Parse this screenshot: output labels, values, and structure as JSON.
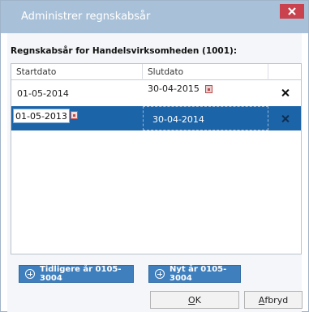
{
  "window": {
    "title": "Administrer regnskabsår"
  },
  "heading": "Regnskabsår for Handelsvirksomheden (1001):",
  "grid": {
    "columns": [
      "Startdato",
      "Slutdato",
      ""
    ],
    "rows": [
      {
        "start": "01-05-2014",
        "end": "30-04-2015",
        "selected": false
      },
      {
        "start": "01-05-2013",
        "end": "30-04-2014",
        "selected": true
      }
    ]
  },
  "buttons": {
    "previous_year": "Tidligere år 0105-3004",
    "new_year": "Nyt år 0105-3004",
    "ok_mnemonic": "O",
    "ok_rest": "K",
    "cancel_mnemonic": "A",
    "cancel_rest": "fbryd"
  },
  "icons": {
    "close": "close-icon",
    "calendar": "calendar-icon",
    "delete": "delete-icon",
    "add": "plus-circle-icon"
  },
  "colors": {
    "titlebar": "#a9c1d8",
    "close": "#c9424d",
    "selection": "#1c64a8",
    "action_button": "#3f7fbd"
  }
}
